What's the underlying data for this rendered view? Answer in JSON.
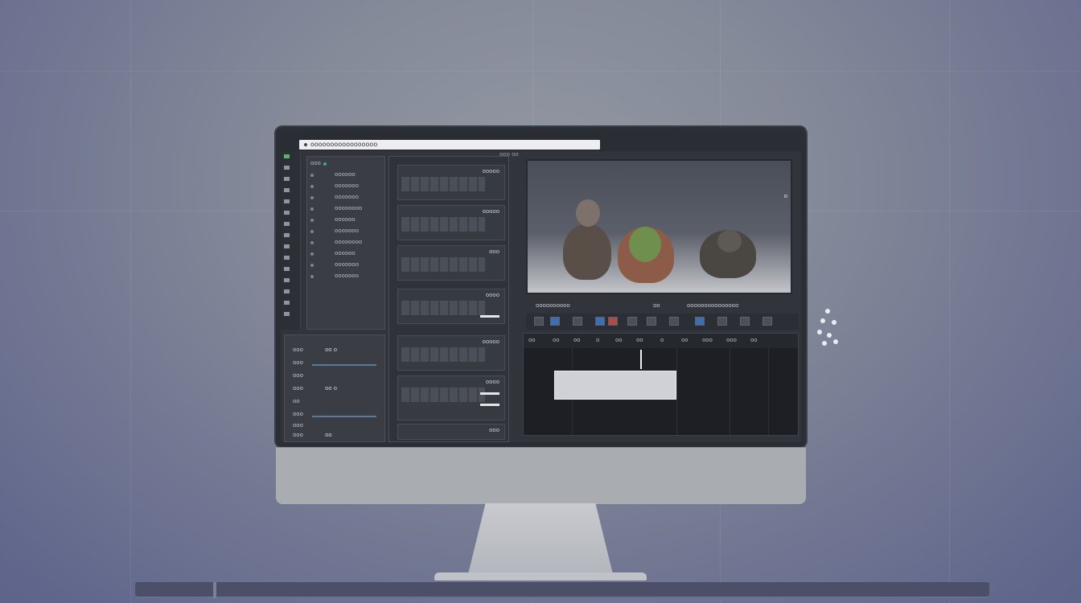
{
  "browser": {
    "url": "ooooooooooooooooo",
    "tab_indicator": "ooo oo"
  },
  "media_list": {
    "items": [
      {
        "label": "ooo",
        "accent": true
      },
      {
        "label": "oooooo"
      },
      {
        "label": "ooooooo"
      },
      {
        "label": "ooooooo"
      },
      {
        "label": "oooooooo"
      },
      {
        "label": "oooooo"
      },
      {
        "label": "ooooooo"
      },
      {
        "label": "oooooooo"
      },
      {
        "label": "oooooo"
      },
      {
        "label": "ooooooo"
      },
      {
        "label": "ooooooo"
      }
    ]
  },
  "properties": {
    "rows": [
      {
        "label": "ooo",
        "value": "oo o"
      },
      {
        "label": "ooo",
        "value": ""
      },
      {
        "label": "ooo",
        "value": ""
      },
      {
        "label": "ooo",
        "value": "oo o"
      },
      {
        "label": "oo",
        "value": ""
      },
      {
        "label": "ooo",
        "value": ""
      },
      {
        "label": "ooo",
        "value": ""
      },
      {
        "label": "ooo",
        "value": "oo"
      }
    ]
  },
  "clips": {
    "items": [
      {
        "label": "ooooo"
      },
      {
        "label": "ooooo"
      },
      {
        "label": "ooo"
      },
      {
        "label": "oooo"
      },
      {
        "label": "ooooo"
      },
      {
        "label": "oooo"
      },
      {
        "label": "ooo"
      }
    ]
  },
  "viewer": {
    "side_label": "o"
  },
  "transport": {
    "left_timecode": "oooooooooo",
    "mid_timecode": "oo",
    "right_timecode": "ooooooooooooooo"
  },
  "timeline": {
    "header_items": [
      "oo",
      "oo",
      "oo",
      "o",
      "oo",
      "oo",
      "o",
      "oo",
      "ooo",
      "ooo",
      "oo"
    ],
    "clip_label": ""
  },
  "colors": {
    "accent": "#3fa3b0",
    "highlight": "#5db36d",
    "playhead": "#eef0f3"
  }
}
